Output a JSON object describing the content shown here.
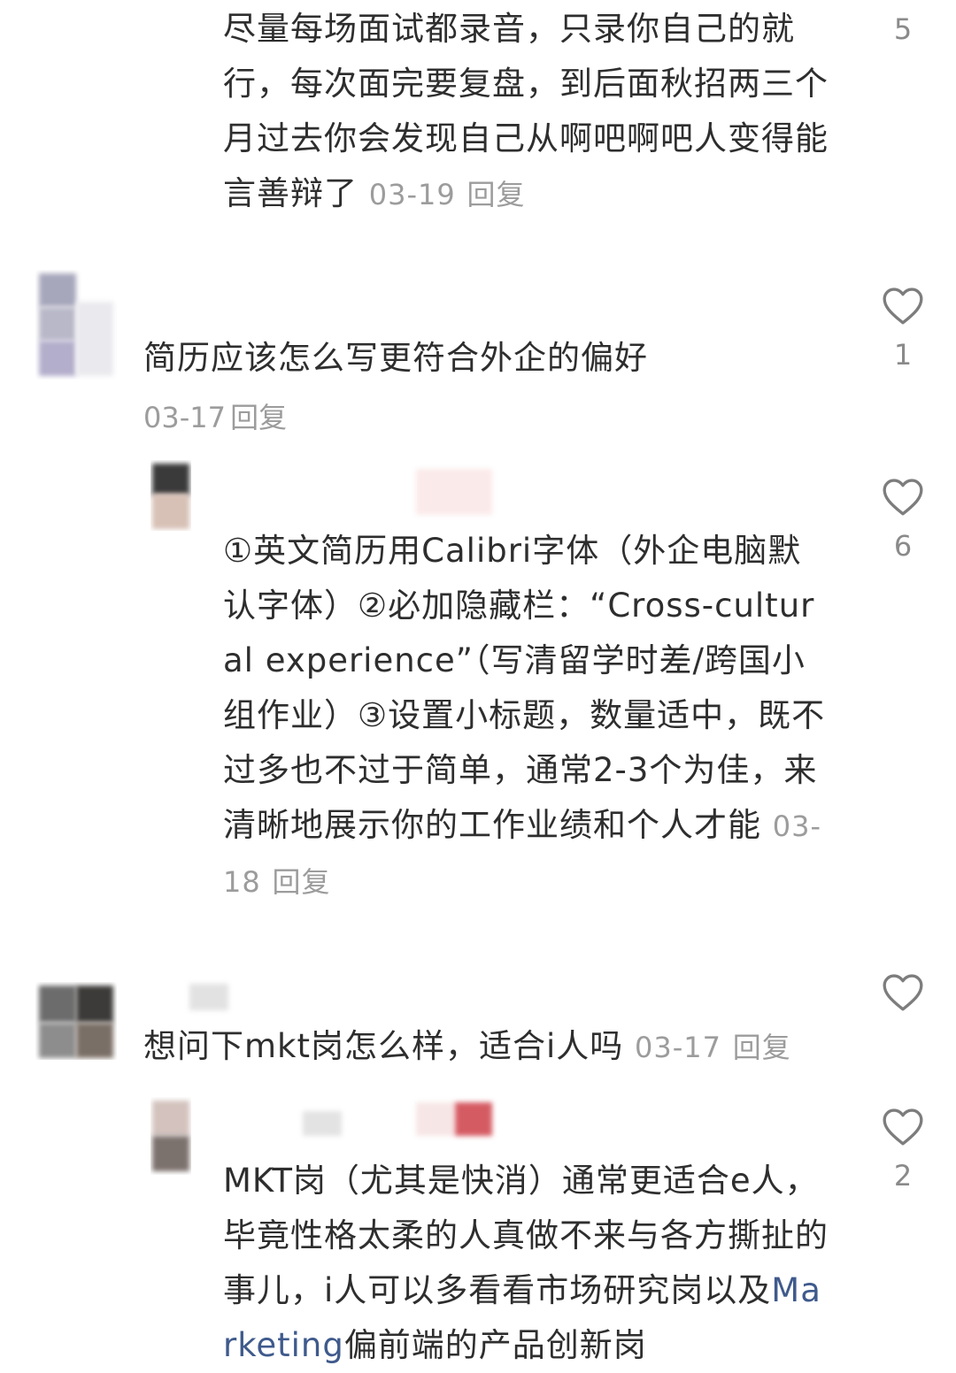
{
  "comments": [
    {
      "id": "c0",
      "text": "尽量每场面试都录音，只录你自己的就行，每次面完要复盘，到后面秋招两三个月过去你会发现自己从啊吧啊吧人变得能言善辩了",
      "date": "03-19",
      "reply_label": "回复",
      "likes": "5"
    },
    {
      "id": "c1",
      "text": "简历应该怎么写更符合外企的偏好",
      "date": "03-17",
      "reply_label": "回复",
      "likes": "1"
    },
    {
      "id": "c1r",
      "text": "①英文简历用Calibri字体（外企电脑默认字体）②必加隐藏栏：“Cross-cultural experience”（写清留学时差/跨国小组作业）③设置小标题，数量适中，既不过多也不过于简单，通常2-3个为佳，来清晰地展示你的工作业绩和个人才能",
      "date": "03-18",
      "reply_label": "回复",
      "likes": "6"
    },
    {
      "id": "c2",
      "text": "想问下mkt岗怎么样，适合i人吗",
      "date": "03-17",
      "reply_label": "回复",
      "likes": ""
    },
    {
      "id": "c2r",
      "text_prefix": "MKT岗（尤其是快消）通常更适合e人，毕竟性格太柔的人真做不来与各方撕扯的事儿，i人可以多看看市场研究岗以及",
      "text_link": "Marketing",
      "text_suffix": "偏前端的产品创新岗",
      "likes": "2"
    }
  ],
  "colors": {
    "text": "#2e2e2e",
    "meta": "#9c9c9c",
    "link": "#3f5a8c",
    "heart_stroke": "#7d7d7d"
  },
  "icons": {
    "like": "heart-outline-icon"
  }
}
